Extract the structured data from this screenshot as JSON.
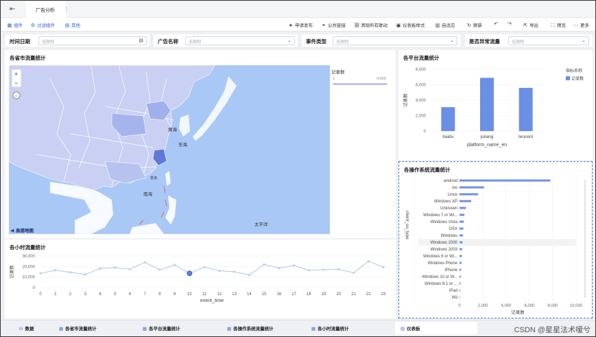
{
  "tabbar": {
    "tab_label": "广告分析"
  },
  "toolbar": {
    "left": [
      {
        "label": "组件",
        "icon": "component-icon"
      },
      {
        "label": "过滤组件",
        "icon": "filter-icon"
      },
      {
        "label": "其他",
        "icon": "other-icon"
      }
    ],
    "right": [
      {
        "label": "申请发布",
        "icon": "send-icon"
      },
      {
        "label": "公共链接",
        "icon": "link-icon"
      },
      {
        "label": "清除所有联动",
        "icon": "unlink-icon"
      },
      {
        "label": "仪表板样式",
        "icon": "style-icon"
      },
      {
        "label": "自适应",
        "icon": "fit-icon"
      },
      {
        "label": "刷新",
        "icon": "refresh-icon"
      },
      {
        "label": "",
        "icon": "undo-icon"
      },
      {
        "label": "",
        "icon": "redo-icon"
      },
      {
        "label": "导出",
        "icon": "export-icon"
      },
      {
        "label": "预览",
        "icon": "preview-icon"
      },
      {
        "label": "更多",
        "icon": "more-icon"
      }
    ]
  },
  "filters": [
    {
      "label": "时间日期",
      "placeholder": "无限制"
    },
    {
      "label": "广告名称",
      "placeholder": "无限制"
    },
    {
      "label": "事件类型",
      "placeholder": "无限制"
    },
    {
      "label": "是否异常流量",
      "placeholder": "无限制"
    }
  ],
  "map_panel": {
    "title": "各省市流量统计",
    "legend_title": "记录数",
    "legend_min": "1",
    "legend_max": "4,500",
    "attribution": "高德地图",
    "zoom_in": "+",
    "zoom_out": "−",
    "places": [
      "黄海",
      "东海",
      "南海",
      "太平洋",
      "香港"
    ]
  },
  "colors": {
    "accent": "#3460d0",
    "bar": "#6c8fe6",
    "line": "#bccbf1",
    "sea": "#a9c8f6",
    "land": "#c9d0f3",
    "land_dark": "#7b8fe0",
    "land_mid": "#9fb0ea"
  },
  "platform_panel": {
    "title": "各平台流量统计"
  },
  "os_panel": {
    "title": "各操作系统流量统计"
  },
  "hour_panel": {
    "title": "各小时流量统计"
  },
  "bottom_tabs": [
    {
      "label": "数据",
      "icon": "database-icon"
    },
    {
      "label": "各省市流量统计",
      "icon": "chart-icon"
    },
    {
      "label": "各平台流量统计",
      "icon": "chart-icon"
    },
    {
      "label": "各操作系统流量统计",
      "icon": "chart-icon"
    },
    {
      "label": "各小时流量统计",
      "icon": "chart-icon"
    },
    {
      "label": "仪表板",
      "icon": "dashboard-icon"
    }
  ],
  "watermark": "CSDN @星星法术嗳兮",
  "chart_data": [
    {
      "type": "bar",
      "title": "各平台流量统计",
      "xlabel": "platform_name_en",
      "ylabel": "记录数",
      "categories": [
        "baidu",
        "juliang",
        "tencent"
      ],
      "values": [
        3100,
        6900,
        5600
      ],
      "ylim": [
        0,
        8000
      ],
      "yticks": [
        "0",
        "2,000",
        "4,000",
        "6,000",
        "8,000"
      ],
      "legend_title": "指标名称",
      "series": [
        {
          "name": "记录数",
          "values": [
            3100,
            6900,
            5600
          ]
        }
      ],
      "legend": "top-right"
    },
    {
      "type": "bar",
      "orientation": "horizontal",
      "title": "各操作系统流量统计",
      "xlabel": "记录数",
      "ylabel": "client_os_type",
      "categories": [
        "android",
        "ios",
        "Linux",
        "Windows XP",
        "Unknown",
        "Windows 7 or Wi...",
        "Windows Vista",
        "OSX",
        "Windows",
        "Windows 2000",
        "Windows 2003",
        "Windows 8 or Wi...",
        "Windows Phone",
        "iPhone",
        "Windows 10 or W...",
        "Windows 8.1 or ...",
        "iPad",
        "Wii"
      ],
      "values": [
        7800,
        2100,
        1600,
        1000,
        550,
        420,
        370,
        330,
        300,
        260,
        230,
        200,
        170,
        140,
        110,
        90,
        70,
        40
      ],
      "xlim": [
        0,
        10000
      ],
      "xticks": [
        "0",
        "2,000",
        "4,000",
        "6,000",
        "8,000",
        "10,000"
      ]
    },
    {
      "type": "line",
      "title": "各小时流量统计",
      "xlabel": "event_time",
      "ylabel": "记录数",
      "x": [
        0,
        1,
        2,
        3,
        4,
        5,
        6,
        7,
        8,
        9,
        10,
        11,
        12,
        13,
        14,
        15,
        16,
        17,
        18,
        19,
        20,
        21,
        22,
        23
      ],
      "values": [
        13500,
        16500,
        14500,
        12500,
        18000,
        19000,
        17500,
        24000,
        17000,
        21500,
        13500,
        19500,
        16000,
        15000,
        12000,
        22000,
        18500,
        21000,
        16500,
        17000,
        17500,
        14000,
        25000,
        19500
      ],
      "ylim": [
        0,
        30000
      ],
      "yticks": [
        "0",
        "10,000",
        "20,000",
        "30,000"
      ]
    }
  ]
}
